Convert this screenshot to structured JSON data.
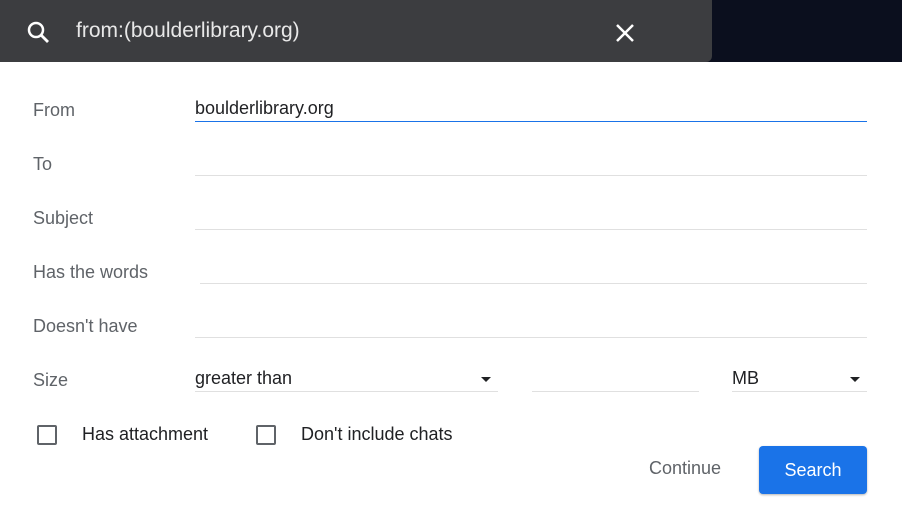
{
  "search": {
    "query": "from:(boulderlibrary.org)"
  },
  "form": {
    "from": {
      "label": "From",
      "value": "boulderlibrary.org"
    },
    "to": {
      "label": "To",
      "value": ""
    },
    "subject": {
      "label": "Subject",
      "value": ""
    },
    "has_words": {
      "label": "Has the words",
      "value": ""
    },
    "doesnt_have": {
      "label": "Doesn't have",
      "value": ""
    },
    "size": {
      "label": "Size",
      "operator": "greater than",
      "value": "",
      "unit": "MB"
    },
    "has_attachment": {
      "label": "Has attachment",
      "checked": false
    },
    "no_chats": {
      "label": "Don't include chats",
      "checked": false
    }
  },
  "actions": {
    "continue": "Continue",
    "search": "Search"
  },
  "colors": {
    "accent": "#1a73e8",
    "search_bar": "#3c3d40"
  }
}
